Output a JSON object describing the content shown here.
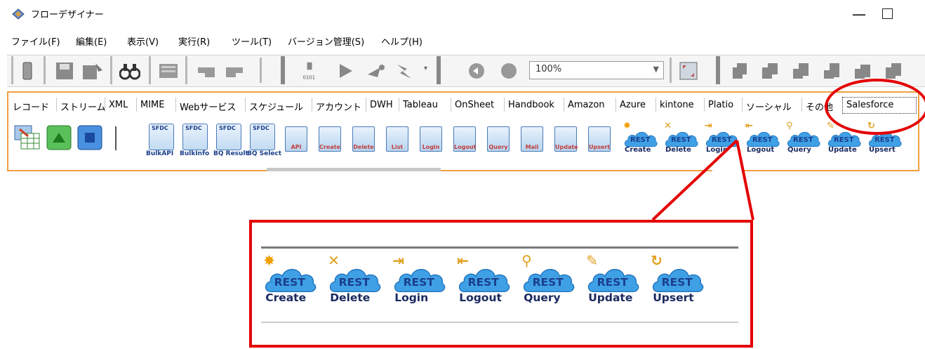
{
  "window": {
    "title": "フローデザイナー",
    "minimize_glyph": "—"
  },
  "menu": [
    "ファイル(F)",
    "編集(E)",
    "表示(V)",
    "実行(R)",
    "ツール(T)",
    "バージョン管理(S)",
    "ヘルプ(H)"
  ],
  "toolbar": {
    "zoom_value": "100%",
    "icons": [
      "new-icon",
      "save-icon",
      "save-as-icon",
      "find-icon",
      "properties-icon",
      "undo-icon",
      "redo-icon",
      "debug-icon",
      "run-icon",
      "step-icon",
      "step-into-icon",
      "stop-icon",
      "back-icon",
      "forward-icon",
      "fit-icon",
      "align-icons"
    ]
  },
  "palette_tabs": [
    "レコード",
    "ストリーム",
    "XML",
    "MIME",
    "Webサービス",
    "スケジュール",
    "アカウント",
    "DWH",
    "Tableau",
    "OnSheet",
    "Handbook",
    "Amazon",
    "Azure",
    "kintone",
    "Platio",
    "ソーシャル",
    "その他",
    "Salesforce"
  ],
  "selected_tab": "Salesforce",
  "palette_items": {
    "basic": [
      "grid-icon",
      "start-icon",
      "end-icon"
    ],
    "sfdc": [
      {
        "head": "SFDC",
        "label": "BulkAPI"
      },
      {
        "head": "SFDC",
        "label": "BulkInfo"
      },
      {
        "head": "SFDC",
        "label": "BQ Result"
      },
      {
        "head": "SFDC",
        "label": "BQ Select"
      }
    ],
    "ae": [
      "API",
      "Create",
      "Delete",
      "List",
      "Login",
      "Logout",
      "Query",
      "Mail",
      "Update",
      "Upsert"
    ],
    "rest": [
      "Create",
      "Delete",
      "Login",
      "Logout",
      "Query",
      "Update",
      "Upsert"
    ]
  },
  "rest_badge": "REST",
  "colors": {
    "highlight_red": "#e40000",
    "palette_border": "#f0a040",
    "cloud_blue": "#3fa0e6"
  }
}
